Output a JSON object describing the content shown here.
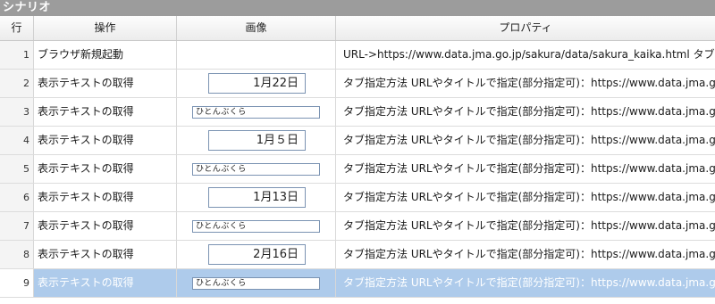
{
  "window": {
    "title": "シナリオ"
  },
  "columns": {
    "line": "行",
    "operation": "操作",
    "image": "画像",
    "property": "プロパティ"
  },
  "rows": [
    {
      "num": "1",
      "operation": "ブラウザ新規起動",
      "image_kind": "none",
      "image_text": "",
      "property": "URL->https://www.data.jma.go.jp/sakura/data/sakura_kaika.html タブ名： / 実行"
    },
    {
      "num": "2",
      "operation": "表示テキストの取得",
      "image_kind": "date",
      "image_text": "1月22日",
      "property": "タブ指定方法 URLやタイトルで指定(部分指定可)：https://www.data.jma.go.jp/sak"
    },
    {
      "num": "3",
      "operation": "表示テキストの取得",
      "image_kind": "name",
      "image_text": "ひとんぶくら",
      "property": "タブ指定方法 URLやタイトルで指定(部分指定可)：https://www.data.jma.go.jp/sak"
    },
    {
      "num": "4",
      "operation": "表示テキストの取得",
      "image_kind": "date",
      "image_text": "1月５日",
      "property": "タブ指定方法 URLやタイトルで指定(部分指定可)：https://www.data.jma.go.jp/sak"
    },
    {
      "num": "5",
      "operation": "表示テキストの取得",
      "image_kind": "name",
      "image_text": "ひとんぶくら",
      "property": "タブ指定方法 URLやタイトルで指定(部分指定可)：https://www.data.jma.go.jp/sak"
    },
    {
      "num": "6",
      "operation": "表示テキストの取得",
      "image_kind": "date",
      "image_text": "1月13日",
      "property": "タブ指定方法 URLやタイトルで指定(部分指定可)：https://www.data.jma.go.jp/sak"
    },
    {
      "num": "7",
      "operation": "表示テキストの取得",
      "image_kind": "name",
      "image_text": "ひとんぶくら",
      "property": "タブ指定方法 URLやタイトルで指定(部分指定可)：https://www.data.jma.go.jp/sak"
    },
    {
      "num": "8",
      "operation": "表示テキストの取得",
      "image_kind": "date",
      "image_text": "2月16日",
      "property": "タブ指定方法 URLやタイトルで指定(部分指定可)：https://www.data.jma.go.jp/sak"
    },
    {
      "num": "9",
      "operation": "表示テキストの取得",
      "image_kind": "name",
      "image_text": "ひとんぶくら",
      "property": "タブ指定方法 URLやタイトルで指定(部分指定可)：https://www.data.jma.go.jp/sak",
      "selected": true
    }
  ],
  "colors": {
    "title_bar": "#9c9c9c",
    "selection": "#aecbeb",
    "image_border": "#7b93b2"
  }
}
